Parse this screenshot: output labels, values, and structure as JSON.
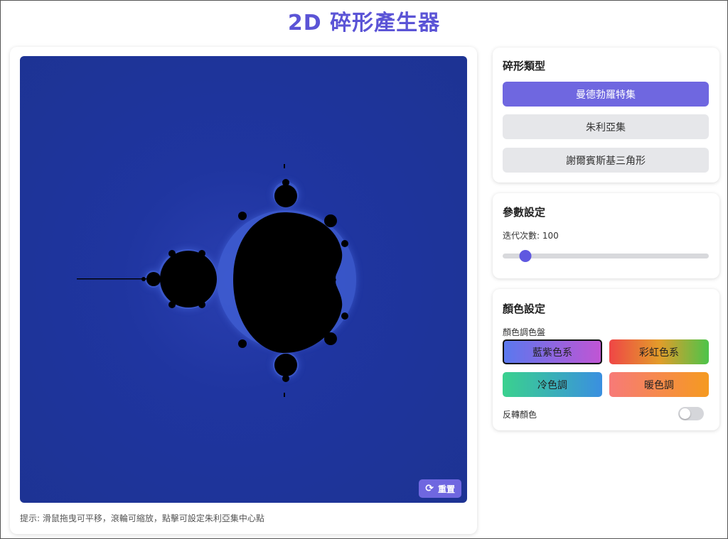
{
  "app": {
    "title": "2D 碎形產生器"
  },
  "canvas": {
    "reset_label": "重置",
    "reset_icon": "refresh-icon",
    "hint": "提示: 滑鼠拖曳可平移，滾輪可縮放，點擊可設定朱利亞集中心點",
    "background_color": "#1f35a0",
    "set_color": "#000000"
  },
  "fractal_type": {
    "heading": "碎形類型",
    "options": [
      "曼德勃羅特集",
      "朱利亞集",
      "謝爾賓斯基三角形"
    ],
    "selected_index": 0
  },
  "params": {
    "heading": "參數設定",
    "iterations_label": "迭代次數: 100",
    "iterations_value": 100,
    "iterations_fraction": 0.11
  },
  "colors": {
    "heading": "顏色設定",
    "palette_label": "顏色調色盤",
    "palettes": [
      "藍紫色系",
      "彩虹色系",
      "冷色調",
      "暖色調"
    ],
    "selected_palette_index": 0,
    "invert_label": "反轉顏色",
    "invert_on": false,
    "accent": "#6f67e0"
  }
}
